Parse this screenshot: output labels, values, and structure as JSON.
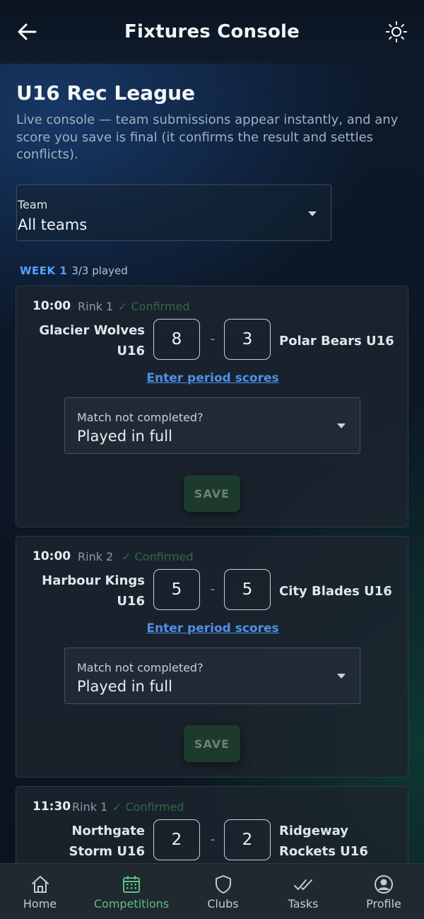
{
  "header": {
    "title": "Fixtures Console",
    "back_icon": "arrow-left-icon",
    "theme_icon": "sun-icon"
  },
  "league": {
    "title": "U16 Rec League",
    "description": "Live console — team submissions appear instantly, and any score you save is final (it confirms the result and settles conflicts)."
  },
  "team_filter": {
    "label": "Team",
    "value": "All teams"
  },
  "week": {
    "label": "WEEK 1",
    "played": "3/3 played"
  },
  "fixtures": [
    {
      "time": "10:00",
      "rink": "Rink 1",
      "status": "✓ Confirmed",
      "home_line1": "Glacier Wolves",
      "home_line2": "U16",
      "home_score": "8",
      "separator": "-",
      "away_score": "3",
      "away_line1": "Polar Bears U16",
      "away_line2": "",
      "period_link": "Enter period scores",
      "completion_label": "Match not completed?",
      "completion_value": "Played in full",
      "save_label": "SAVE"
    },
    {
      "time": "10:00",
      "rink": "Rink 2",
      "status": "✓ Confirmed",
      "home_line1": "Harbour Kings",
      "home_line2": "U16",
      "home_score": "5",
      "separator": "-",
      "away_score": "5",
      "away_line1": "City Blades U16",
      "away_line2": "",
      "period_link": "Enter period scores",
      "completion_label": "Match not completed?",
      "completion_value": "Played in full",
      "save_label": "SAVE"
    },
    {
      "time": "11:30",
      "rink": "Rink 1",
      "status": "✓ Confirmed",
      "home_line1": "Northgate",
      "home_line2": "Storm U16",
      "home_score": "2",
      "separator": "-",
      "away_score": "2",
      "away_line1": "Ridgeway",
      "away_line2": "Rockets U16"
    }
  ],
  "nav": [
    {
      "label": "Home",
      "icon": "home-icon",
      "active": false
    },
    {
      "label": "Competitions",
      "icon": "calendar-icon",
      "active": true
    },
    {
      "label": "Clubs",
      "icon": "shield-icon",
      "active": false
    },
    {
      "label": "Tasks",
      "icon": "double-check-icon",
      "active": false
    },
    {
      "label": "Profile",
      "icon": "profile-icon",
      "active": false
    }
  ],
  "colors": {
    "accent_blue": "#4f8fe8",
    "confirmed_green": "#2f6a45",
    "nav_active": "#5fbf7f"
  }
}
